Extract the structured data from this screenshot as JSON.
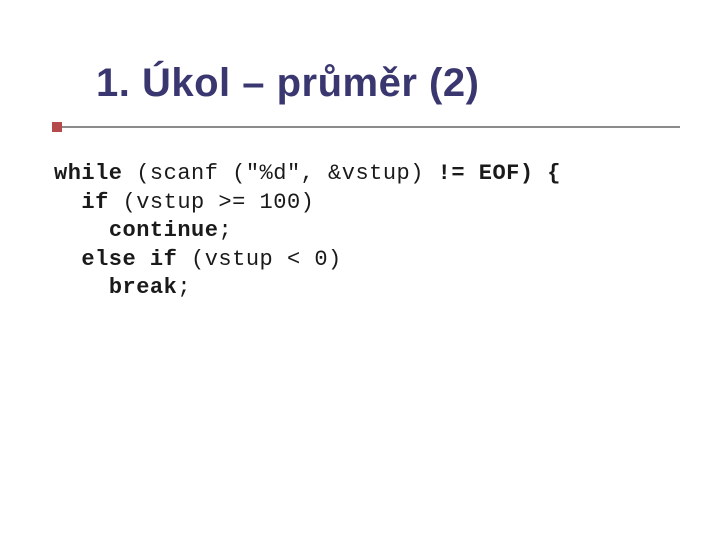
{
  "slide": {
    "title": "1. Úkol – průměr (2)"
  },
  "code": {
    "l1": {
      "while": "while",
      "paren": " (scanf (\"%d\", &vstup) ",
      "neq": "!= EOF) {"
    },
    "l2": {
      "indent": "  ",
      "if": "if",
      "rest": " (vstup >= 100)"
    },
    "l3": {
      "indent": "    ",
      "continue": "continue",
      "semi": ";"
    },
    "l4": {
      "indent": "  ",
      "elseif": "else if",
      "rest": " (vstup < 0)"
    },
    "l5": {
      "indent": "    ",
      "break": "break",
      "semi": ";"
    }
  }
}
